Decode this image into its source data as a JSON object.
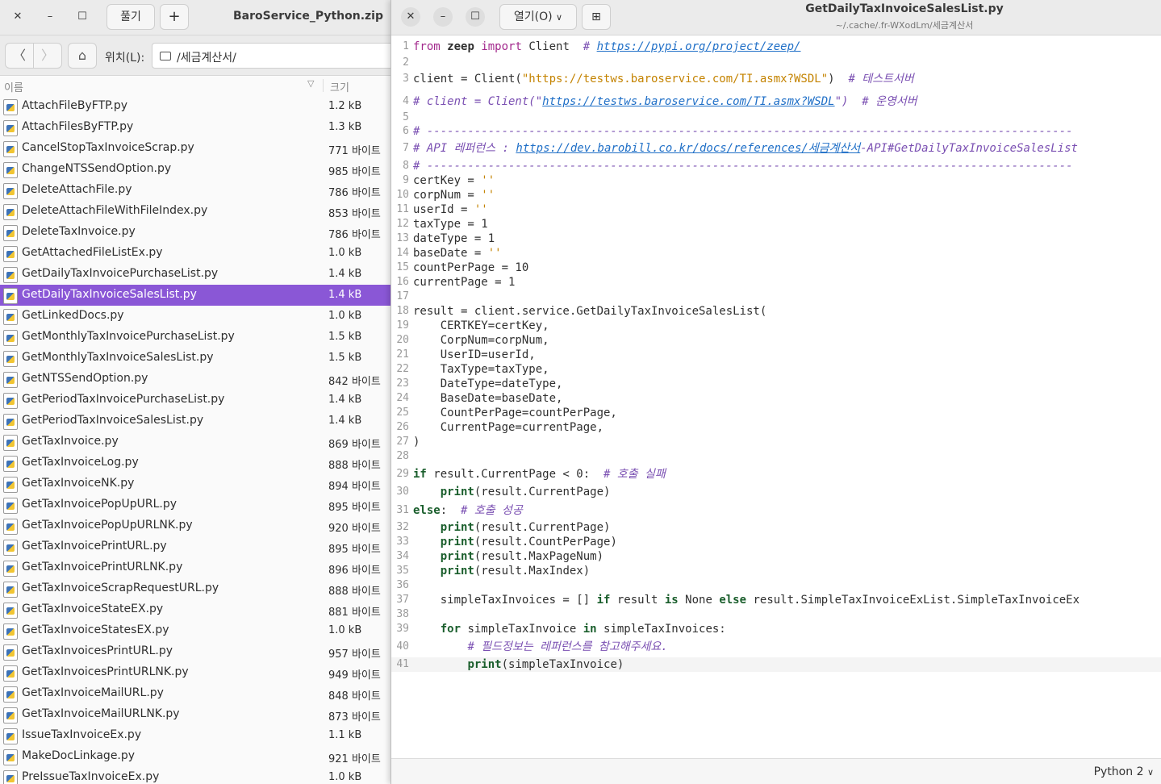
{
  "archive": {
    "title": "BaroService_Python.zip",
    "extract_label": "풀기",
    "location_label": "위치(L):",
    "location_path": "/세금계산서/",
    "columns": {
      "name": "이름",
      "size": "크기"
    },
    "files": [
      {
        "name": "AttachFileByFTP.py",
        "size": "1.2 kB"
      },
      {
        "name": "AttachFilesByFTP.py",
        "size": "1.3 kB"
      },
      {
        "name": "CancelStopTaxInvoiceScrap.py",
        "size": "771 바이트"
      },
      {
        "name": "ChangeNTSSendOption.py",
        "size": "985 바이트"
      },
      {
        "name": "DeleteAttachFile.py",
        "size": "786 바이트"
      },
      {
        "name": "DeleteAttachFileWithFileIndex.py",
        "size": "853 바이트"
      },
      {
        "name": "DeleteTaxInvoice.py",
        "size": "786 바이트"
      },
      {
        "name": "GetAttachedFileListEx.py",
        "size": "1.0 kB"
      },
      {
        "name": "GetDailyTaxInvoicePurchaseList.py",
        "size": "1.4 kB"
      },
      {
        "name": "GetDailyTaxInvoiceSalesList.py",
        "size": "1.4 kB",
        "selected": true
      },
      {
        "name": "GetLinkedDocs.py",
        "size": "1.0 kB"
      },
      {
        "name": "GetMonthlyTaxInvoicePurchaseList.py",
        "size": "1.5 kB"
      },
      {
        "name": "GetMonthlyTaxInvoiceSalesList.py",
        "size": "1.5 kB"
      },
      {
        "name": "GetNTSSendOption.py",
        "size": "842 바이트"
      },
      {
        "name": "GetPeriodTaxInvoicePurchaseList.py",
        "size": "1.4 kB"
      },
      {
        "name": "GetPeriodTaxInvoiceSalesList.py",
        "size": "1.4 kB"
      },
      {
        "name": "GetTaxInvoice.py",
        "size": "869 바이트"
      },
      {
        "name": "GetTaxInvoiceLog.py",
        "size": "888 바이트"
      },
      {
        "name": "GetTaxInvoiceNK.py",
        "size": "894 바이트"
      },
      {
        "name": "GetTaxInvoicePopUpURL.py",
        "size": "895 바이트"
      },
      {
        "name": "GetTaxInvoicePopUpURLNK.py",
        "size": "920 바이트"
      },
      {
        "name": "GetTaxInvoicePrintURL.py",
        "size": "895 바이트"
      },
      {
        "name": "GetTaxInvoicePrintURLNK.py",
        "size": "896 바이트"
      },
      {
        "name": "GetTaxInvoiceScrapRequestURL.py",
        "size": "888 바이트"
      },
      {
        "name": "GetTaxInvoiceStateEX.py",
        "size": "881 바이트"
      },
      {
        "name": "GetTaxInvoiceStatesEX.py",
        "size": "1.0 kB"
      },
      {
        "name": "GetTaxInvoicesPrintURL.py",
        "size": "957 바이트"
      },
      {
        "name": "GetTaxInvoicesPrintURLNK.py",
        "size": "949 바이트"
      },
      {
        "name": "GetTaxInvoiceMailURL.py",
        "size": "848 바이트"
      },
      {
        "name": "GetTaxInvoiceMailURLNK.py",
        "size": "873 바이트"
      },
      {
        "name": "IssueTaxInvoiceEx.py",
        "size": "1.1 kB"
      },
      {
        "name": "MakeDocLinkage.py",
        "size": "921 바이트"
      },
      {
        "name": "PreIssueTaxInvoiceEx.py",
        "size": "1.0 kB"
      }
    ]
  },
  "editor": {
    "title": "GetDailyTaxInvoiceSalesList.py",
    "subtitle": "~/.cache/.fr-WXodLm/세금계산서",
    "open_label": "열기(O)",
    "language": "Python 2",
    "current_line": 41,
    "lines": [
      {
        "n": 1,
        "parts": [
          [
            "kw",
            "from"
          ],
          [
            "t",
            " "
          ],
          [
            "bold",
            "zeep"
          ],
          [
            "t",
            " "
          ],
          [
            "kw",
            "import"
          ],
          [
            "t",
            " Client  "
          ],
          [
            "cm",
            "# "
          ],
          [
            "url",
            "https://pypi.org/project/zeep/"
          ]
        ]
      },
      {
        "n": 2,
        "parts": []
      },
      {
        "n": 3,
        "parts": [
          [
            "t",
            "client = Client("
          ],
          [
            "str",
            "\"https://testws.baroservice.com/TI.asmx?WSDL\""
          ],
          [
            "t",
            ")  "
          ],
          [
            "cm",
            "# 테스트서버"
          ]
        ]
      },
      {
        "n": 4,
        "parts": [
          [
            "cm",
            "# client = Client(\""
          ],
          [
            "url",
            "https://testws.baroservice.com/TI.asmx?WSDL"
          ],
          [
            "cm",
            "\")  # 운영서버"
          ]
        ]
      },
      {
        "n": 5,
        "parts": []
      },
      {
        "n": 6,
        "parts": [
          [
            "cm",
            "# -----------------------------------------------------------------------------------------------"
          ]
        ]
      },
      {
        "n": 7,
        "parts": [
          [
            "cm",
            "# API 레퍼런스 : "
          ],
          [
            "url",
            "https://dev.barobill.co.kr/docs/references/세금계산서"
          ],
          [
            "cm",
            "-API#GetDailyTaxInvoiceSalesList"
          ]
        ]
      },
      {
        "n": 8,
        "parts": [
          [
            "cm",
            "# -----------------------------------------------------------------------------------------------"
          ]
        ]
      },
      {
        "n": 9,
        "parts": [
          [
            "t",
            "certKey = "
          ],
          [
            "str",
            "''"
          ]
        ]
      },
      {
        "n": 10,
        "parts": [
          [
            "t",
            "corpNum = "
          ],
          [
            "str",
            "''"
          ]
        ]
      },
      {
        "n": 11,
        "parts": [
          [
            "t",
            "userId = "
          ],
          [
            "str",
            "''"
          ]
        ]
      },
      {
        "n": 12,
        "parts": [
          [
            "t",
            "taxType = 1"
          ]
        ]
      },
      {
        "n": 13,
        "parts": [
          [
            "t",
            "dateType = 1"
          ]
        ]
      },
      {
        "n": 14,
        "parts": [
          [
            "t",
            "baseDate = "
          ],
          [
            "str",
            "''"
          ]
        ]
      },
      {
        "n": 15,
        "parts": [
          [
            "t",
            "countPerPage = 10"
          ]
        ]
      },
      {
        "n": 16,
        "parts": [
          [
            "t",
            "currentPage = 1"
          ]
        ]
      },
      {
        "n": 17,
        "parts": []
      },
      {
        "n": 18,
        "parts": [
          [
            "t",
            "result = client.service.GetDailyTaxInvoiceSalesList("
          ]
        ]
      },
      {
        "n": 19,
        "parts": [
          [
            "t",
            "    CERTKEY=certKey,"
          ]
        ]
      },
      {
        "n": 20,
        "parts": [
          [
            "t",
            "    CorpNum=corpNum,"
          ]
        ]
      },
      {
        "n": 21,
        "parts": [
          [
            "t",
            "    UserID=userId,"
          ]
        ]
      },
      {
        "n": 22,
        "parts": [
          [
            "t",
            "    TaxType=taxType,"
          ]
        ]
      },
      {
        "n": 23,
        "parts": [
          [
            "t",
            "    DateType=dateType,"
          ]
        ]
      },
      {
        "n": 24,
        "parts": [
          [
            "t",
            "    BaseDate=baseDate,"
          ]
        ]
      },
      {
        "n": 25,
        "parts": [
          [
            "t",
            "    CountPerPage=countPerPage,"
          ]
        ]
      },
      {
        "n": 26,
        "parts": [
          [
            "t",
            "    CurrentPage=currentPage,"
          ]
        ]
      },
      {
        "n": 27,
        "parts": [
          [
            "t",
            ")"
          ]
        ]
      },
      {
        "n": 28,
        "parts": []
      },
      {
        "n": 29,
        "parts": [
          [
            "kwb",
            "if"
          ],
          [
            "t",
            " result.CurrentPage < 0:  "
          ],
          [
            "cm",
            "# 호출 실패"
          ]
        ]
      },
      {
        "n": 30,
        "parts": [
          [
            "t",
            "    "
          ],
          [
            "kwb",
            "print"
          ],
          [
            "t",
            "(result.CurrentPage)"
          ]
        ]
      },
      {
        "n": 31,
        "parts": [
          [
            "kwb",
            "else"
          ],
          [
            "t",
            ":  "
          ],
          [
            "cm",
            "# 호출 성공"
          ]
        ]
      },
      {
        "n": 32,
        "parts": [
          [
            "t",
            "    "
          ],
          [
            "kwb",
            "print"
          ],
          [
            "t",
            "(result.CurrentPage)"
          ]
        ]
      },
      {
        "n": 33,
        "parts": [
          [
            "t",
            "    "
          ],
          [
            "kwb",
            "print"
          ],
          [
            "t",
            "(result.CountPerPage)"
          ]
        ]
      },
      {
        "n": 34,
        "parts": [
          [
            "t",
            "    "
          ],
          [
            "kwb",
            "print"
          ],
          [
            "t",
            "(result.MaxPageNum)"
          ]
        ]
      },
      {
        "n": 35,
        "parts": [
          [
            "t",
            "    "
          ],
          [
            "kwb",
            "print"
          ],
          [
            "t",
            "(result.MaxIndex)"
          ]
        ]
      },
      {
        "n": 36,
        "parts": []
      },
      {
        "n": 37,
        "parts": [
          [
            "t",
            "    simpleTaxInvoices = [] "
          ],
          [
            "kwb",
            "if"
          ],
          [
            "t",
            " result "
          ],
          [
            "kwb",
            "is"
          ],
          [
            "t",
            " None "
          ],
          [
            "kwb",
            "else"
          ],
          [
            "t",
            " result.SimpleTaxInvoiceExList.SimpleTaxInvoiceEx"
          ]
        ]
      },
      {
        "n": 38,
        "parts": []
      },
      {
        "n": 39,
        "parts": [
          [
            "t",
            "    "
          ],
          [
            "kwb",
            "for"
          ],
          [
            "t",
            " simpleTaxInvoice "
          ],
          [
            "kwb",
            "in"
          ],
          [
            "t",
            " simpleTaxInvoices:"
          ]
        ]
      },
      {
        "n": 40,
        "parts": [
          [
            "t",
            "        "
          ],
          [
            "cm",
            "# 필드정보는 레퍼런스를 참고해주세요."
          ]
        ]
      },
      {
        "n": 41,
        "parts": [
          [
            "t",
            "        "
          ],
          [
            "kwb",
            "print"
          ],
          [
            "t",
            "(simpleTaxInvoice)"
          ]
        ]
      }
    ]
  }
}
